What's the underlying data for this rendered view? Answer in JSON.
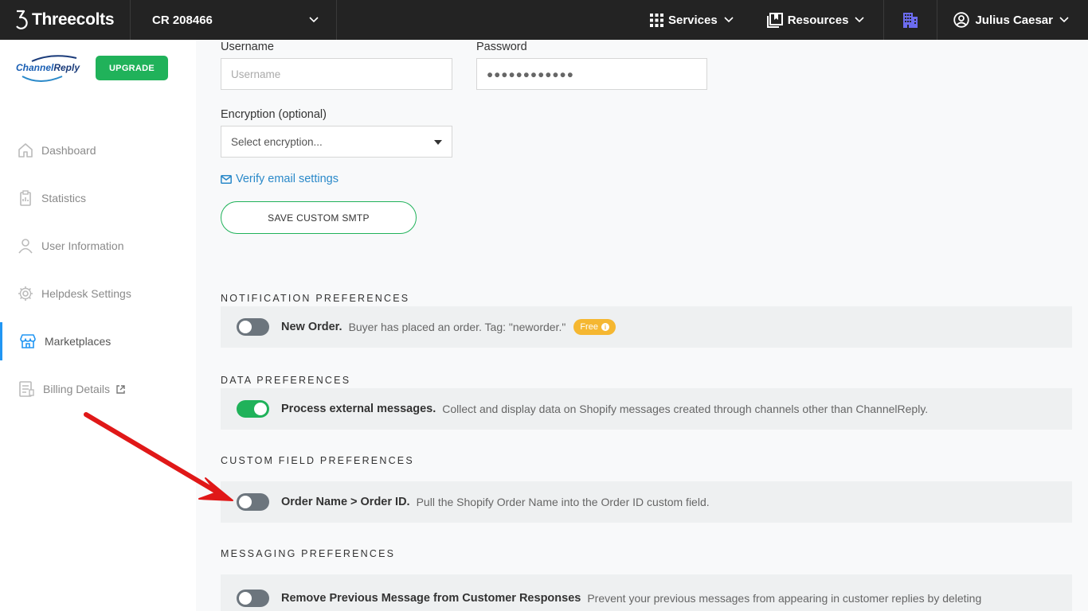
{
  "topbar": {
    "brand": "Threecolts",
    "account": "CR 208466",
    "services": "Services",
    "resources": "Resources",
    "user": "Julius Caesar"
  },
  "sidebar": {
    "logo_text_a": "Channel",
    "logo_text_b": "Reply",
    "upgrade": "UPGRADE",
    "items": [
      {
        "label": "Dashboard",
        "icon": "home-icon"
      },
      {
        "label": "Statistics",
        "icon": "clipboard-icon"
      },
      {
        "label": "User Information",
        "icon": "user-icon"
      },
      {
        "label": "Helpdesk Settings",
        "icon": "gear-icon"
      },
      {
        "label": "Marketplaces",
        "icon": "store-icon",
        "active": true
      },
      {
        "label": "Billing Details",
        "icon": "invoice-icon"
      }
    ]
  },
  "form": {
    "username_label": "Username",
    "username_placeholder": "Username",
    "password_label": "Password",
    "password_value": "●●●●●●●●●●●●",
    "encryption_label": "Encryption (optional)",
    "encryption_placeholder": "Select encryption...",
    "verify_link": "Verify email settings",
    "save_button": "SAVE CUSTOM SMTP"
  },
  "sections": {
    "notification": {
      "title": "NOTIFICATION PREFERENCES",
      "item_title": "New Order.",
      "item_desc": "Buyer has placed an order. Tag: \"neworder.\"",
      "badge": "Free",
      "badge_info": "i",
      "enabled": false
    },
    "data": {
      "title": "DATA PREFERENCES",
      "item_title": "Process external messages.",
      "item_desc": "Collect and display data on Shopify messages created through channels other than ChannelReply.",
      "enabled": true
    },
    "custom_field": {
      "title": "CUSTOM FIELD PREFERENCES",
      "item_title": "Order Name > Order ID.",
      "item_desc": "Pull the Shopify Order Name into the Order ID custom field.",
      "enabled": false
    },
    "messaging": {
      "title": "MESSAGING PREFERENCES",
      "item_title": "Remove Previous Message from Customer Responses",
      "item_desc": "Prevent your previous messages from appearing in customer replies by deleting",
      "enabled": false
    }
  },
  "colors": {
    "topbar": "#232323",
    "accent_green": "#20b25a",
    "link_blue": "#2a89c9",
    "badge_orange": "#f5b731",
    "annotation_red": "#e01818"
  }
}
